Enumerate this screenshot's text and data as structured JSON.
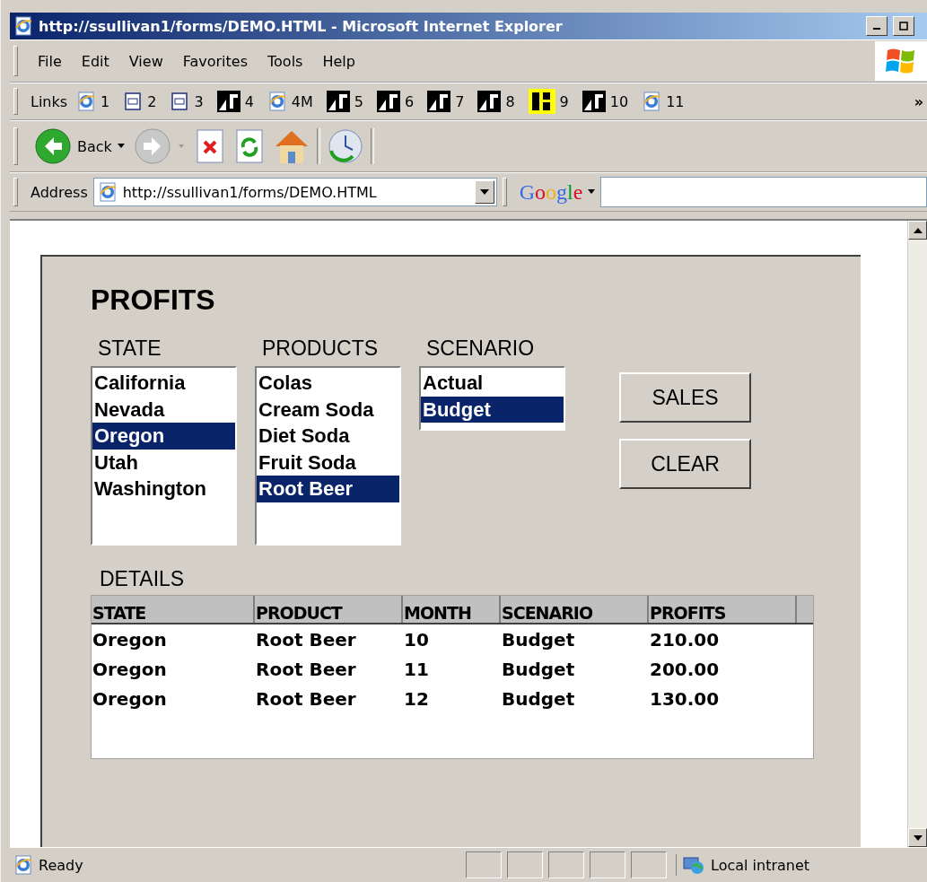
{
  "window": {
    "title": "http://ssullivan1/forms/DEMO.HTML - Microsoft Internet Explorer"
  },
  "menu": [
    "File",
    "Edit",
    "View",
    "Favorites",
    "Tools",
    "Help"
  ],
  "links": {
    "label": "Links",
    "more": "»",
    "items": [
      {
        "label": "1",
        "kind": "ie"
      },
      {
        "label": "2",
        "kind": "db"
      },
      {
        "label": "3",
        "kind": "db"
      },
      {
        "label": "4",
        "kind": "black"
      },
      {
        "label": "4M",
        "kind": "ie"
      },
      {
        "label": "5",
        "kind": "black"
      },
      {
        "label": "6",
        "kind": "black"
      },
      {
        "label": "7",
        "kind": "black"
      },
      {
        "label": "8",
        "kind": "black"
      },
      {
        "label": "9",
        "kind": "yellow"
      },
      {
        "label": "10",
        "kind": "black"
      },
      {
        "label": "11",
        "kind": "ie"
      }
    ]
  },
  "toolbar": {
    "back": "Back"
  },
  "address": {
    "label": "Address",
    "value": "http://ssullivan1/forms/DEMO.HTML"
  },
  "search": {
    "brand": "Google"
  },
  "page": {
    "title": "PROFITS",
    "lists": [
      {
        "label": "STATE",
        "items": [
          {
            "text": "California",
            "selected": false
          },
          {
            "text": "Nevada",
            "selected": false
          },
          {
            "text": "Oregon",
            "selected": true
          },
          {
            "text": "Utah",
            "selected": false
          },
          {
            "text": "Washington",
            "selected": false
          }
        ]
      },
      {
        "label": "PRODUCTS",
        "items": [
          {
            "text": "Colas",
            "selected": false
          },
          {
            "text": "Cream Soda",
            "selected": false
          },
          {
            "text": "Diet Soda",
            "selected": false
          },
          {
            "text": "Fruit Soda",
            "selected": false
          },
          {
            "text": "Root Beer",
            "selected": true
          }
        ]
      },
      {
        "label": "SCENARIO",
        "items": [
          {
            "text": "Actual",
            "selected": false
          },
          {
            "text": "Budget",
            "selected": true
          }
        ]
      }
    ],
    "buttons": [
      "SALES",
      "CLEAR"
    ],
    "details": {
      "label": "DETAILS",
      "columns": [
        "STATE",
        "PRODUCT",
        "MONTH",
        "SCENARIO",
        "PROFITS"
      ],
      "rows": [
        [
          "Oregon",
          "Root Beer",
          "10",
          "Budget",
          "210.00"
        ],
        [
          "Oregon",
          "Root Beer",
          "11",
          "Budget",
          "200.00"
        ],
        [
          "Oregon",
          "Root Beer",
          "12",
          "Budget",
          "130.00"
        ]
      ]
    }
  },
  "status": {
    "text": "Ready",
    "zone": "Local intranet"
  }
}
